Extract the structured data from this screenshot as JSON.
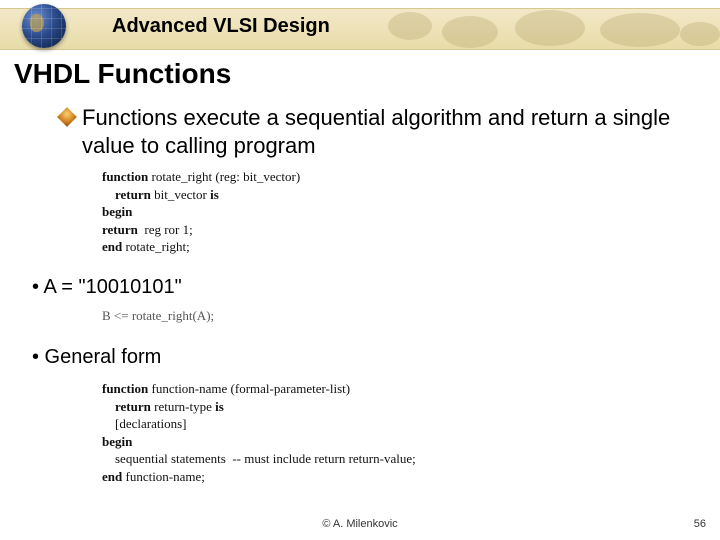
{
  "header": {
    "course_title": "Advanced VLSI Design"
  },
  "slide": {
    "title": "VHDL Functions",
    "bullet_main": "Functions execute a sequential algorithm and return a single value to calling program",
    "code_example": {
      "l1a": "function",
      "l1b": " rotate_right (reg: bit_vector)",
      "l2a": "return",
      "l2b": " bit_vector ",
      "l2c": "is",
      "l3": "begin",
      "l4a": "return",
      "l4b": "  reg ror 1;",
      "l5a": "end",
      "l5b": " rotate_right;"
    },
    "sub1_label": "•  A = \"10010101\"",
    "call_line": "B <= rotate_right(A);",
    "sub2_label": "•  General form",
    "general_form": {
      "l1a": "function",
      "l1b": " function-name (formal-parameter-list)",
      "l2a": "return",
      "l2b": " return-type ",
      "l2c": "is",
      "l3": "[declarations]",
      "l4": "begin",
      "l5": "sequential statements  -- must include return return-value;",
      "l6a": "end",
      "l6b": " function-name;"
    }
  },
  "footer": {
    "copyright": "©  A. Milenkovic",
    "page": "56"
  }
}
